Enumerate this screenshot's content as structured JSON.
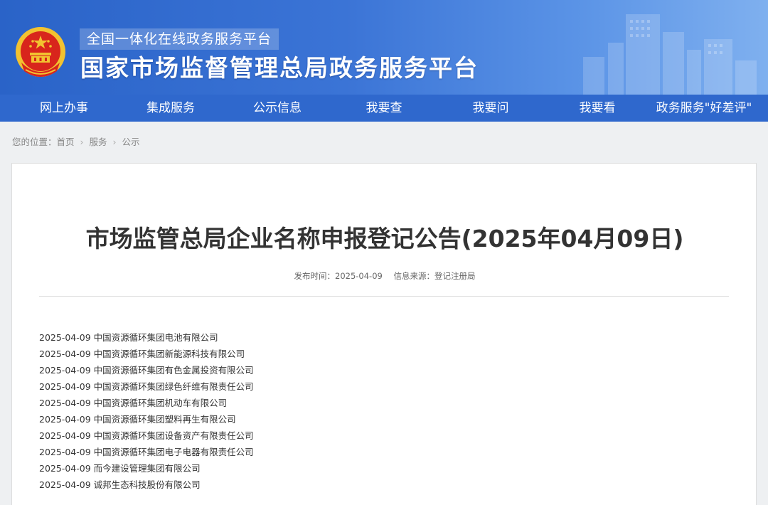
{
  "header": {
    "slogan": "全国一体化在线政务服务平台",
    "title": "国家市场监督管理总局政务服务平台"
  },
  "nav": {
    "items": [
      {
        "label": "网上办事"
      },
      {
        "label": "集成服务"
      },
      {
        "label": "公示信息"
      },
      {
        "label": "我要查"
      },
      {
        "label": "我要问"
      },
      {
        "label": "我要看"
      },
      {
        "label": "政务服务\"好差评\""
      }
    ]
  },
  "breadcrumb": {
    "prefix": "您的位置：",
    "items": [
      "首页",
      "服务",
      "公示"
    ]
  },
  "article": {
    "title": "市场监管总局企业名称申报登记公告(2025年04月09日)",
    "publish_time": "发布时间：2025-04-09",
    "source": "信息来源：登记注册局",
    "entries": [
      "2025-04-09 中国资源循环集团电池有限公司",
      "2025-04-09 中国资源循环集团新能源科技有限公司",
      "2025-04-09 中国资源循环集团有色金属投资有限公司",
      "2025-04-09 中国资源循环集团绿色纤维有限责任公司",
      "2025-04-09 中国资源循环集团机动车有限公司",
      "2025-04-09 中国资源循环集团塑料再生有限公司",
      "2025-04-09 中国资源循环集团设备资产有限责任公司",
      "2025-04-09 中国资源循环集团电子电器有限责任公司",
      "2025-04-09 而今建设管理集团有限公司",
      "2025-04-09 诚邦生态科技股份有限公司"
    ]
  },
  "colors": {
    "banner": "#2a63c8",
    "nav": "#2f68cd",
    "emblem_red": "#d8251c",
    "emblem_gold": "#f2c230"
  }
}
